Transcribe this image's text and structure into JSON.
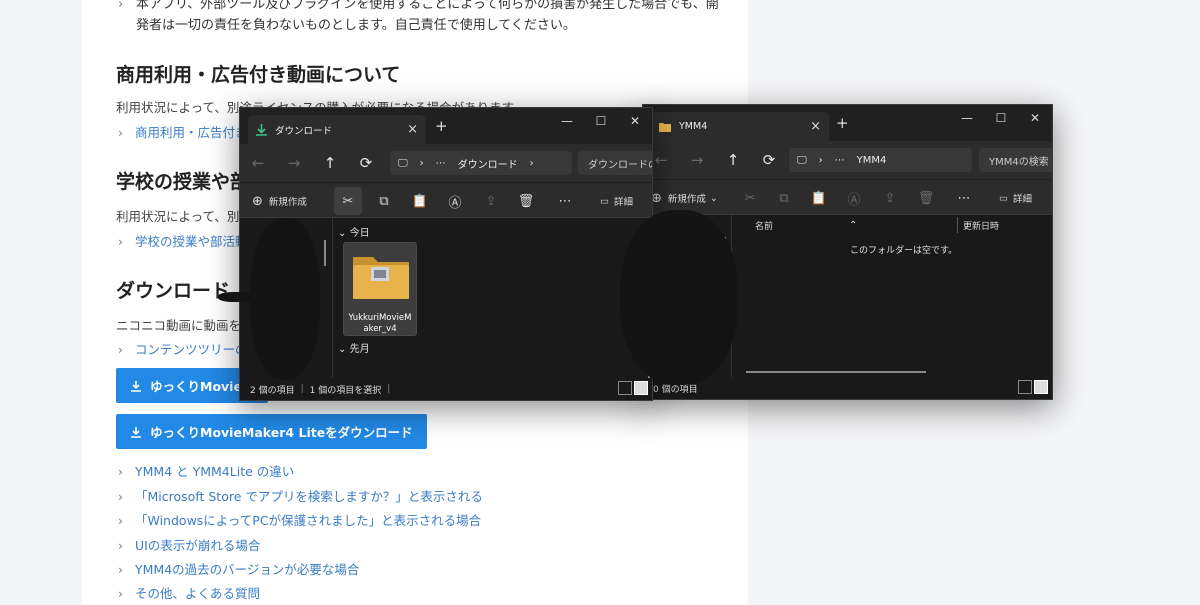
{
  "page": {
    "note": "本アプリ、外部ツール及びプラグインを使用することによって何らかの損害が発生した場合でも、開発者は一切の責任を負わないものとします。自己責任で使用してください。",
    "sections": [
      {
        "heading": "商用利用・広告付き動画について",
        "text": "利用状況によって、別途ライセンスの購入が必要になる場合があります",
        "link": "商用利用・広告付き"
      },
      {
        "heading": "学校の授業や部",
        "text": "利用状況によって、別",
        "link": "学校の授業や部活動"
      },
      {
        "heading": "ダウンロード",
        "text": "ニコニコ動画に動画を",
        "link": "コンテンツツリーの"
      }
    ],
    "buttons": [
      "ゆっくりMovieM",
      "ゆっくりMovieMaker4 Liteをダウンロード"
    ],
    "links": [
      "YMM4 と YMM4Lite の違い",
      "「Microsoft Store でアプリを検索しますか？」と表示される",
      "「WindowsによってPCが保護されました」と表示される場合",
      "UIの表示が崩れる場合",
      "YMM4の過去のバージョンが必要な場合",
      "その他、よくある質問"
    ]
  },
  "explorer1": {
    "tab_title": "ダウンロード",
    "address": [
      "⋯",
      "ダウンロード"
    ],
    "search_placeholder": "ダウンロードの検",
    "new_label": "新規作成",
    "details_label": "詳細",
    "groups": [
      "今日",
      "先月"
    ],
    "item_name": "YukkuriMovieMaker_v4",
    "status_count": "2 個の項目",
    "status_selected": "1 個の項目を選択"
  },
  "explorer2": {
    "tab_title": "YMM4",
    "address": [
      "⋯",
      "YMM4"
    ],
    "search_placeholder": "YMM4の検索",
    "new_label": "新規作成",
    "details_label": "詳細",
    "col_name": "名前",
    "col_date": "更新日時",
    "empty_message": "このフォルダーは空です。",
    "status_count": "0 個の項目"
  },
  "colors": {
    "link": "#3a7cc4",
    "button": "#2289e6",
    "explorer_bg": "#1c1c1c",
    "folder": "#e7b34a"
  }
}
